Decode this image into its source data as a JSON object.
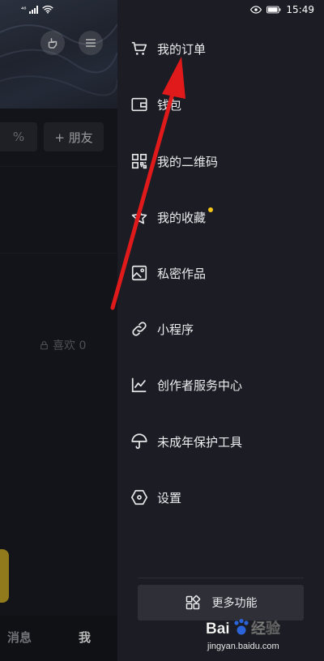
{
  "status_bar": {
    "time": "15:49",
    "signal_small": "⁴⁶"
  },
  "profile": {
    "add_friend_label": "+ 朋友",
    "percent_fragment": "%",
    "likes_label": "喜欢 0",
    "nav": {
      "messages": "消息",
      "me": "我"
    }
  },
  "drawer": {
    "items": [
      {
        "label": "我的订单",
        "icon": "cart-icon"
      },
      {
        "label": "钱包",
        "icon": "wallet-icon"
      },
      {
        "label": "我的二维码",
        "icon": "qrcode-icon"
      },
      {
        "label": "我的收藏",
        "icon": "star-icon",
        "badge_color": "#f5c518"
      },
      {
        "label": "私密作品",
        "icon": "image-icon"
      },
      {
        "label": "小程序",
        "icon": "link-icon"
      },
      {
        "label": "创作者服务中心",
        "icon": "chart-icon"
      },
      {
        "label": "未成年保护工具",
        "icon": "umbrella-icon"
      },
      {
        "label": "设置",
        "icon": "hexagon-settings-icon"
      }
    ],
    "more_button_label": "更多功能"
  },
  "watermark": {
    "brand": "Baidu 经验",
    "url": "jingyan.baidu.com"
  },
  "colors": {
    "annotation_arrow": "#e0191b",
    "badge": "#f5c518",
    "yellow_tab": "#c9a928"
  }
}
